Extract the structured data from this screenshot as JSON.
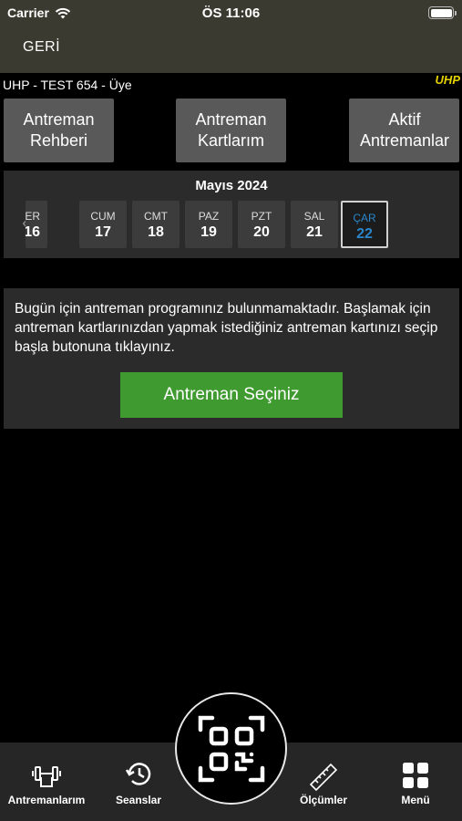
{
  "status_bar": {
    "carrier": "Carrier",
    "time": "ÖS 11:06"
  },
  "nav": {
    "back_label": "GERİ"
  },
  "user": {
    "line": "UHP - TEST 654 - Üye",
    "logo": "UHP"
  },
  "top_buttons": [
    {
      "label": "Antreman\nRehberi"
    },
    {
      "label": "Antreman\nKartlarım"
    },
    {
      "label": "Aktif\nAntremanlar"
    }
  ],
  "calendar": {
    "month": "Mayıs 2024",
    "days": [
      {
        "name": "PER",
        "date": "16",
        "active": false
      },
      {
        "name": "CUM",
        "date": "17",
        "active": false
      },
      {
        "name": "CMT",
        "date": "18",
        "active": false
      },
      {
        "name": "PAZ",
        "date": "19",
        "active": false
      },
      {
        "name": "PZT",
        "date": "20",
        "active": false
      },
      {
        "name": "SAL",
        "date": "21",
        "active": false
      },
      {
        "name": "ÇAR",
        "date": "22",
        "active": true
      }
    ]
  },
  "info": {
    "message": "Bugün için antreman programınız bulunmamaktadır. Başlamak için antreman kartlarınızdan yapmak istediğiniz antreman kartınızı seçip başla butonuna tıklayınız.",
    "select_button": "Antreman Seçiniz"
  },
  "tabbar": {
    "items": [
      {
        "label": "Antremanlarım",
        "icon": "dumbbell-icon"
      },
      {
        "label": "Seanslar",
        "icon": "history-icon"
      },
      {
        "label": "Ölçümler",
        "icon": "ruler-icon"
      },
      {
        "label": "Menü",
        "icon": "grid-icon"
      }
    ],
    "center_icon": "qr-code-icon"
  },
  "colors": {
    "header_bg": "#3a3a30",
    "panel_bg": "#2b2b2b",
    "button_bg": "#595959",
    "accent_green": "#3f9a2f",
    "active_day_text": "#2a86c9",
    "logo_yellow": "#e6d200"
  }
}
